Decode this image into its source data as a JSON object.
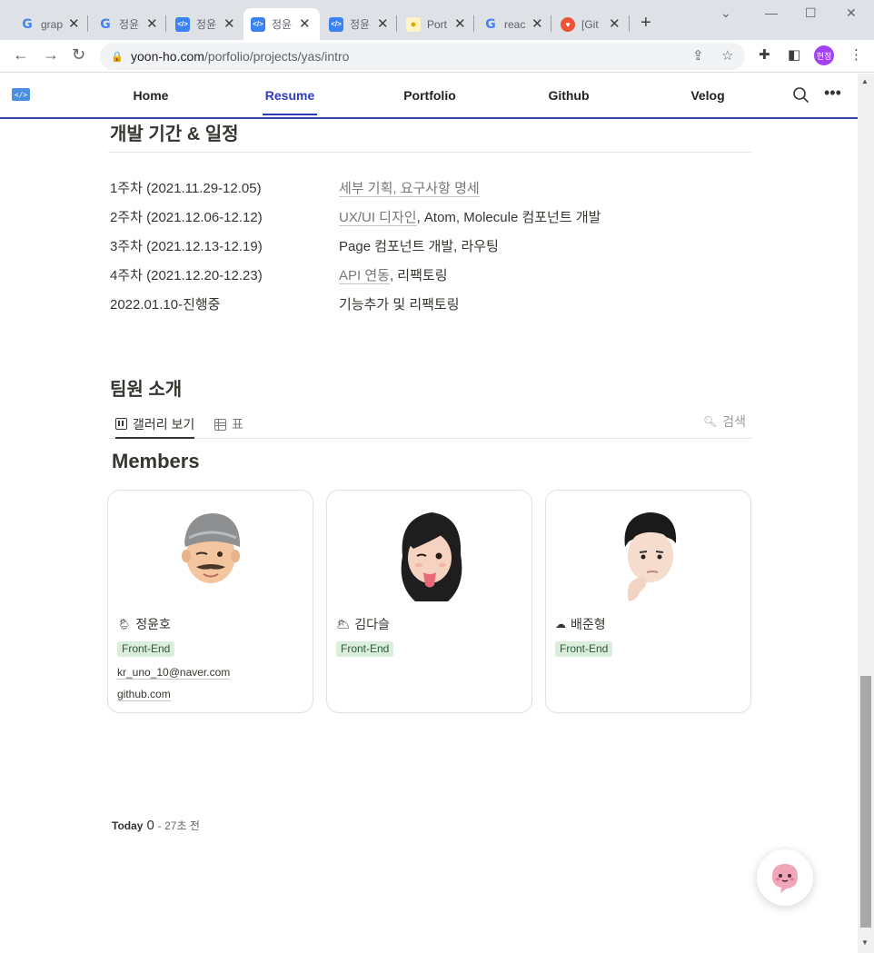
{
  "browser": {
    "tabs": [
      {
        "title": "grap",
        "favicon": "google-icon"
      },
      {
        "title": "정윤",
        "favicon": "google-icon"
      },
      {
        "title": "정윤",
        "favicon": "code-icon"
      },
      {
        "title": "정윤",
        "favicon": "code-icon",
        "active": true
      },
      {
        "title": "정윤",
        "favicon": "code-icon"
      },
      {
        "title": "Port",
        "favicon": "lightbulb-icon"
      },
      {
        "title": "reac",
        "favicon": "google-icon"
      },
      {
        "title": "[Git",
        "favicon": "git-icon"
      }
    ],
    "url_host": "yoon-ho.com",
    "url_path": "/porfolio/projects/yas/intro",
    "profile_initials": "현정"
  },
  "site_nav": {
    "items": [
      "Home",
      "Resume",
      "Portfolio",
      "Github",
      "Velog"
    ],
    "active": "Resume",
    "accent_color": "#2c3bbf"
  },
  "schedule": {
    "heading": "개발 기간 & 일정",
    "rows": [
      {
        "period": "1주차 (2021.11.29-12.05)",
        "link": "세부 기획, 요구사항 명세",
        "rest": ""
      },
      {
        "period": "2주차 (2021.12.06-12.12)",
        "link": "UX/UI 디자인",
        "rest": ", Atom, Molecule 컴포넌트 개발"
      },
      {
        "period": "3주차 (2021.12.13-12.19)",
        "link": "",
        "rest": "Page 컴포넌트 개발, 라우팅"
      },
      {
        "period": "4주차 (2021.12.20-12.23)",
        "link": "API 연동",
        "rest": ", 리팩토링"
      },
      {
        "period": "2022.01.10-진행중",
        "link": "",
        "rest": "기능추가 및 리팩토링"
      }
    ]
  },
  "team": {
    "heading": "팀원 소개",
    "views": {
      "gallery": "갤러리 보기",
      "table": "표"
    },
    "search_label": "검색",
    "gallery_title": "Members",
    "members": [
      {
        "weather": "🌦",
        "name": "정윤호",
        "tag": "Front-End",
        "email": "kr_uno_10@naver.com",
        "link": "github.com"
      },
      {
        "weather": "🌥",
        "name": "김다슬",
        "tag": "Front-End",
        "email": "",
        "link": ""
      },
      {
        "weather": "☁",
        "name": "배준형",
        "tag": "Front-End",
        "email": "",
        "link": ""
      }
    ],
    "tag_color": "#dbeddb"
  },
  "footer": {
    "today_label": "Today",
    "count": "0",
    "ago": "- 27초 전"
  }
}
